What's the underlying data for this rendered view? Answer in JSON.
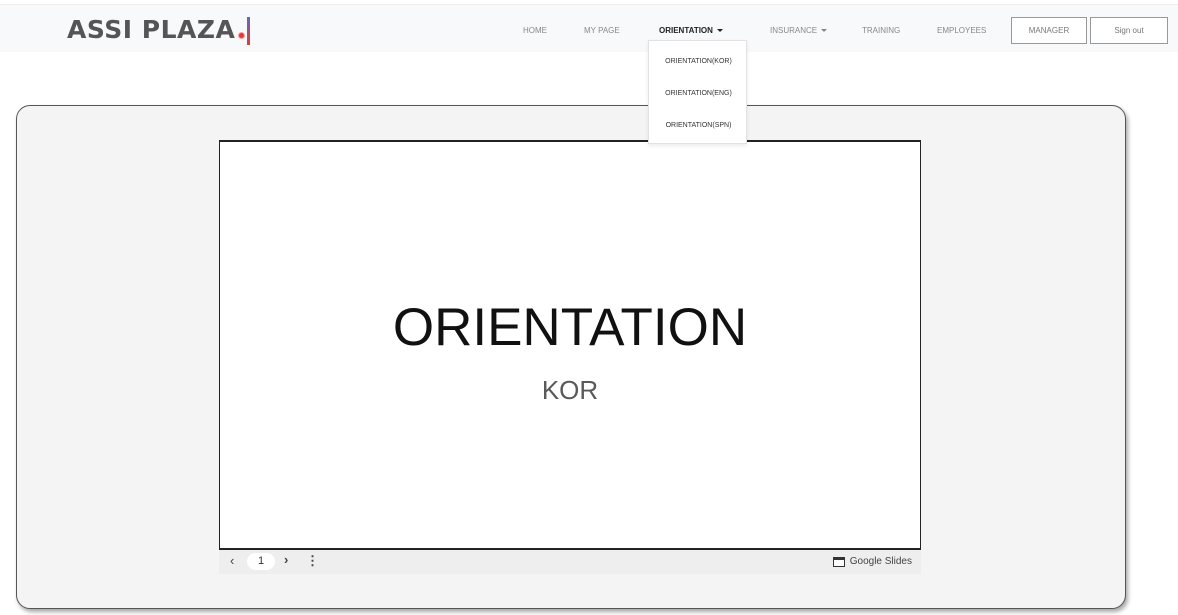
{
  "brand": {
    "name": "ASSI PLAZA"
  },
  "nav": {
    "home": "HOME",
    "my_page": "MY PAGE",
    "orientation": "ORIENTATION",
    "insurance": "INSURANCE",
    "training": "TRAINING",
    "employees": "EMPLOYEES",
    "manager": "MANAGER",
    "sign_out": "Sign out"
  },
  "orientation_menu": {
    "items": [
      "ORIENTATION(KOR)",
      "ORIENTATION(ENG)",
      "ORIENTATION(SPN)"
    ]
  },
  "slide": {
    "title": "ORIENTATION",
    "subtitle": "KOR",
    "page": "1",
    "prev_icon": "chevron-left-icon",
    "next_icon": "chevron-right-icon",
    "menu_icon": "more-vert-icon",
    "provider": "Google Slides"
  },
  "colors": {
    "navbar_bg": "#f8f9fa",
    "brand_text": "#555555",
    "brand_accent_red": "#e53935",
    "brand_accent_blue": "#5c6bc0",
    "panel_bg": "#f4f4f4"
  }
}
